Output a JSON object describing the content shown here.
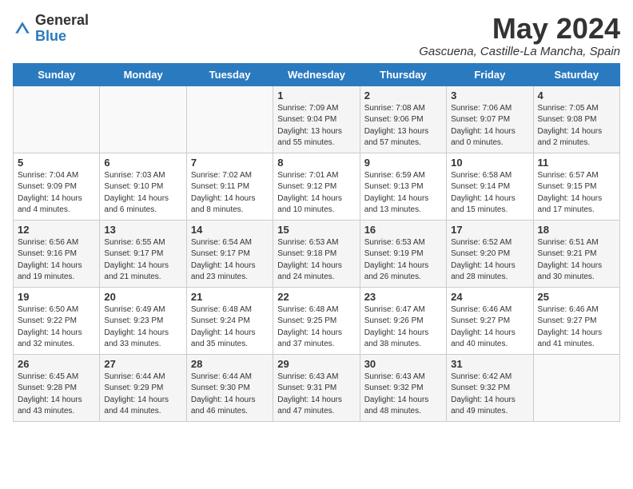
{
  "logo": {
    "general": "General",
    "blue": "Blue"
  },
  "title": "May 2024",
  "subtitle": "Gascuena, Castille-La Mancha, Spain",
  "days_of_week": [
    "Sunday",
    "Monday",
    "Tuesday",
    "Wednesday",
    "Thursday",
    "Friday",
    "Saturday"
  ],
  "weeks": [
    [
      {
        "day": "",
        "info": ""
      },
      {
        "day": "",
        "info": ""
      },
      {
        "day": "",
        "info": ""
      },
      {
        "day": "1",
        "info": "Sunrise: 7:09 AM\nSunset: 9:04 PM\nDaylight: 13 hours\nand 55 minutes."
      },
      {
        "day": "2",
        "info": "Sunrise: 7:08 AM\nSunset: 9:06 PM\nDaylight: 13 hours\nand 57 minutes."
      },
      {
        "day": "3",
        "info": "Sunrise: 7:06 AM\nSunset: 9:07 PM\nDaylight: 14 hours\nand 0 minutes."
      },
      {
        "day": "4",
        "info": "Sunrise: 7:05 AM\nSunset: 9:08 PM\nDaylight: 14 hours\nand 2 minutes."
      }
    ],
    [
      {
        "day": "5",
        "info": "Sunrise: 7:04 AM\nSunset: 9:09 PM\nDaylight: 14 hours\nand 4 minutes."
      },
      {
        "day": "6",
        "info": "Sunrise: 7:03 AM\nSunset: 9:10 PM\nDaylight: 14 hours\nand 6 minutes."
      },
      {
        "day": "7",
        "info": "Sunrise: 7:02 AM\nSunset: 9:11 PM\nDaylight: 14 hours\nand 8 minutes."
      },
      {
        "day": "8",
        "info": "Sunrise: 7:01 AM\nSunset: 9:12 PM\nDaylight: 14 hours\nand 10 minutes."
      },
      {
        "day": "9",
        "info": "Sunrise: 6:59 AM\nSunset: 9:13 PM\nDaylight: 14 hours\nand 13 minutes."
      },
      {
        "day": "10",
        "info": "Sunrise: 6:58 AM\nSunset: 9:14 PM\nDaylight: 14 hours\nand 15 minutes."
      },
      {
        "day": "11",
        "info": "Sunrise: 6:57 AM\nSunset: 9:15 PM\nDaylight: 14 hours\nand 17 minutes."
      }
    ],
    [
      {
        "day": "12",
        "info": "Sunrise: 6:56 AM\nSunset: 9:16 PM\nDaylight: 14 hours\nand 19 minutes."
      },
      {
        "day": "13",
        "info": "Sunrise: 6:55 AM\nSunset: 9:17 PM\nDaylight: 14 hours\nand 21 minutes."
      },
      {
        "day": "14",
        "info": "Sunrise: 6:54 AM\nSunset: 9:17 PM\nDaylight: 14 hours\nand 23 minutes."
      },
      {
        "day": "15",
        "info": "Sunrise: 6:53 AM\nSunset: 9:18 PM\nDaylight: 14 hours\nand 24 minutes."
      },
      {
        "day": "16",
        "info": "Sunrise: 6:53 AM\nSunset: 9:19 PM\nDaylight: 14 hours\nand 26 minutes."
      },
      {
        "day": "17",
        "info": "Sunrise: 6:52 AM\nSunset: 9:20 PM\nDaylight: 14 hours\nand 28 minutes."
      },
      {
        "day": "18",
        "info": "Sunrise: 6:51 AM\nSunset: 9:21 PM\nDaylight: 14 hours\nand 30 minutes."
      }
    ],
    [
      {
        "day": "19",
        "info": "Sunrise: 6:50 AM\nSunset: 9:22 PM\nDaylight: 14 hours\nand 32 minutes."
      },
      {
        "day": "20",
        "info": "Sunrise: 6:49 AM\nSunset: 9:23 PM\nDaylight: 14 hours\nand 33 minutes."
      },
      {
        "day": "21",
        "info": "Sunrise: 6:48 AM\nSunset: 9:24 PM\nDaylight: 14 hours\nand 35 minutes."
      },
      {
        "day": "22",
        "info": "Sunrise: 6:48 AM\nSunset: 9:25 PM\nDaylight: 14 hours\nand 37 minutes."
      },
      {
        "day": "23",
        "info": "Sunrise: 6:47 AM\nSunset: 9:26 PM\nDaylight: 14 hours\nand 38 minutes."
      },
      {
        "day": "24",
        "info": "Sunrise: 6:46 AM\nSunset: 9:27 PM\nDaylight: 14 hours\nand 40 minutes."
      },
      {
        "day": "25",
        "info": "Sunrise: 6:46 AM\nSunset: 9:27 PM\nDaylight: 14 hours\nand 41 minutes."
      }
    ],
    [
      {
        "day": "26",
        "info": "Sunrise: 6:45 AM\nSunset: 9:28 PM\nDaylight: 14 hours\nand 43 minutes."
      },
      {
        "day": "27",
        "info": "Sunrise: 6:44 AM\nSunset: 9:29 PM\nDaylight: 14 hours\nand 44 minutes."
      },
      {
        "day": "28",
        "info": "Sunrise: 6:44 AM\nSunset: 9:30 PM\nDaylight: 14 hours\nand 46 minutes."
      },
      {
        "day": "29",
        "info": "Sunrise: 6:43 AM\nSunset: 9:31 PM\nDaylight: 14 hours\nand 47 minutes."
      },
      {
        "day": "30",
        "info": "Sunrise: 6:43 AM\nSunset: 9:32 PM\nDaylight: 14 hours\nand 48 minutes."
      },
      {
        "day": "31",
        "info": "Sunrise: 6:42 AM\nSunset: 9:32 PM\nDaylight: 14 hours\nand 49 minutes."
      },
      {
        "day": "",
        "info": ""
      }
    ]
  ]
}
